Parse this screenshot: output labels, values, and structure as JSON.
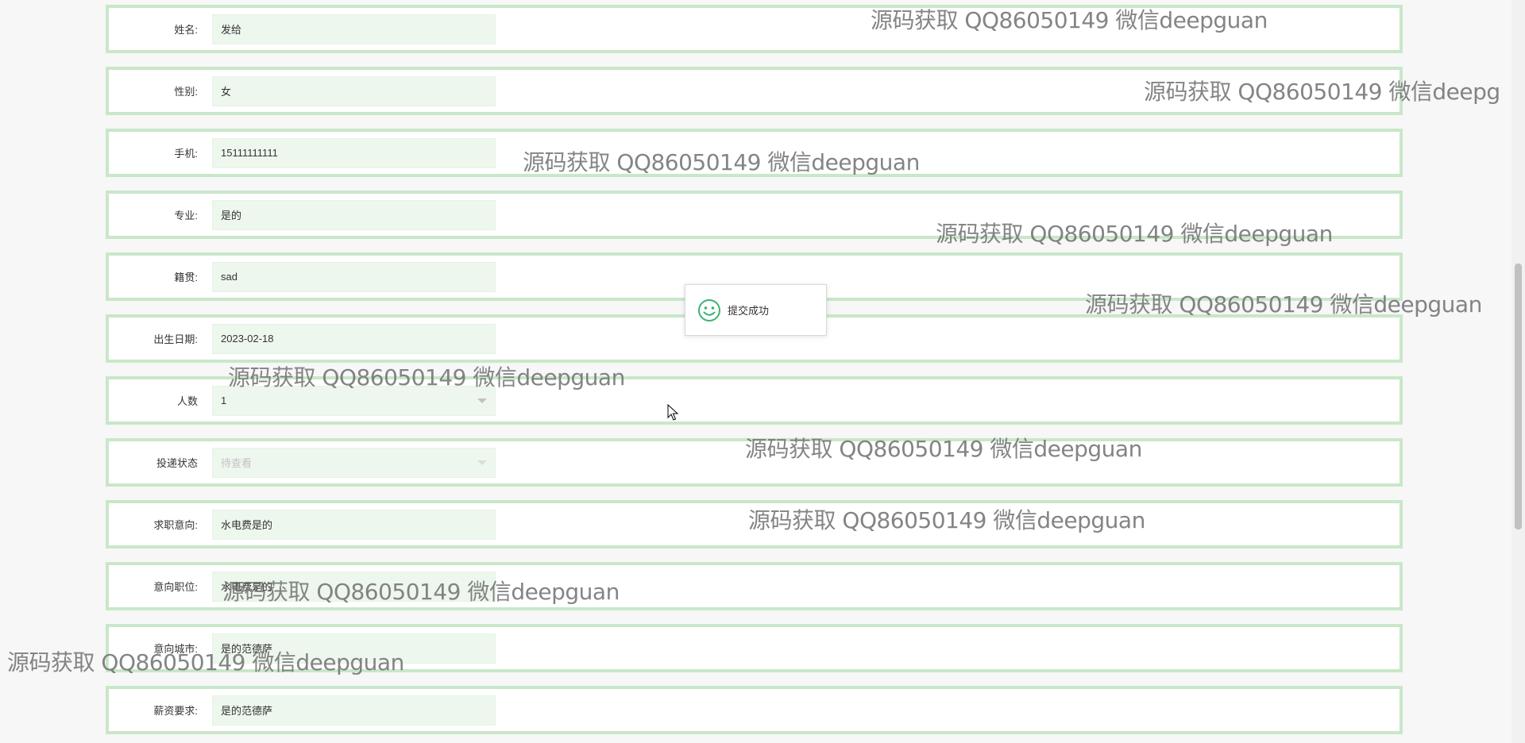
{
  "form": {
    "rows": [
      {
        "label": "姓名:",
        "value": "发给"
      },
      {
        "label": "性别:",
        "value": "女"
      },
      {
        "label": "手机:",
        "value": "15111111111"
      },
      {
        "label": "专业:",
        "value": "是的"
      },
      {
        "label": "籍贯:",
        "value": "sad"
      },
      {
        "label": "出生日期:",
        "value": "2023-02-18"
      },
      {
        "label": "人数",
        "value": "1"
      },
      {
        "label": "投递状态",
        "value": "待查看"
      },
      {
        "label": "求职意向:",
        "value": "水电费是的"
      },
      {
        "label": "意向职位:",
        "value": "水电费是的"
      },
      {
        "label": "意向城市:",
        "value": "是的范德萨"
      },
      {
        "label": "薪资要求:",
        "value": "是的范德萨"
      }
    ]
  },
  "toast": {
    "message": "提交成功",
    "icon": "smile-icon"
  },
  "watermark": {
    "text": "源码获取 QQ86050149 微信deepguan",
    "text_cut": "源码获取 QQ86050149 微信deepg"
  },
  "colors": {
    "row_border": "#c9e7c9",
    "field_bg": "#eef7ee",
    "toast_icon": "#3cb371"
  }
}
